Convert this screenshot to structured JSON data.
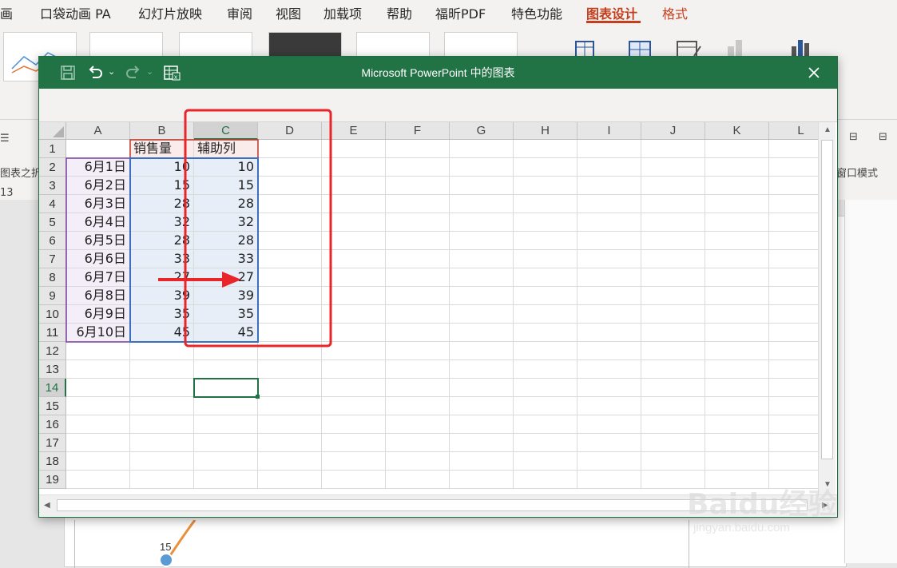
{
  "ppt": {
    "tabs": [
      {
        "label": "画",
        "state": "normal"
      },
      {
        "label": "口袋动画 PA",
        "state": "normal"
      },
      {
        "label": "幻灯片放映",
        "state": "normal"
      },
      {
        "label": "审阅",
        "state": "normal"
      },
      {
        "label": "视图",
        "state": "normal"
      },
      {
        "label": "加载项",
        "state": "normal"
      },
      {
        "label": "帮助",
        "state": "normal"
      },
      {
        "label": "福昕PDF",
        "state": "normal"
      },
      {
        "label": "特色功能",
        "state": "normal"
      },
      {
        "label": "图表设计",
        "state": "active"
      },
      {
        "label": "格式",
        "state": "accent"
      }
    ],
    "left_fragments": {
      "label1": "图表之折",
      "ruler": "13"
    },
    "right_fragments": {
      "window_mode": "窗口模式"
    },
    "slide_point_label": "15"
  },
  "excel_window": {
    "title": "Microsoft PowerPoint 中的图表",
    "toolbar_icons": [
      "save-icon",
      "undo-icon",
      "redo-icon",
      "edit-data-in-excel-icon"
    ],
    "column_headers": [
      "A",
      "B",
      "C",
      "D",
      "E",
      "F",
      "G",
      "H",
      "I",
      "J",
      "K",
      "L"
    ],
    "selected_column": "C",
    "row_headers": [
      "1",
      "2",
      "3",
      "4",
      "5",
      "6",
      "7",
      "8",
      "9",
      "10",
      "11",
      "12",
      "13",
      "14",
      "15",
      "16",
      "17",
      "18",
      "19"
    ],
    "selected_row": "14",
    "table": {
      "header": {
        "a": "",
        "b": "销售量",
        "c": "辅助列"
      },
      "rows": [
        {
          "a": "6月1日",
          "b": "10",
          "c": "10"
        },
        {
          "a": "6月2日",
          "b": "15",
          "c": "15"
        },
        {
          "a": "6月3日",
          "b": "28",
          "c": "28"
        },
        {
          "a": "6月4日",
          "b": "32",
          "c": "32"
        },
        {
          "a": "6月5日",
          "b": "28",
          "c": "28"
        },
        {
          "a": "6月6日",
          "b": "33",
          "c": "33"
        },
        {
          "a": "6月7日",
          "b": "27",
          "c": "27"
        },
        {
          "a": "6月8日",
          "b": "39",
          "c": "39"
        },
        {
          "a": "6月9日",
          "b": "35",
          "c": "35"
        },
        {
          "a": "6月10日",
          "b": "45",
          "c": "45"
        }
      ]
    }
  },
  "colors": {
    "excel_green": "#217346",
    "ppt_accent": "#c43e1c",
    "annotation_red": "#e8262a",
    "series_blue_fill": "#e8eef8",
    "category_purple": "#7b3fa0"
  },
  "watermark": {
    "brand": "Baidu经验",
    "url": "jingyan.baidu.com"
  }
}
